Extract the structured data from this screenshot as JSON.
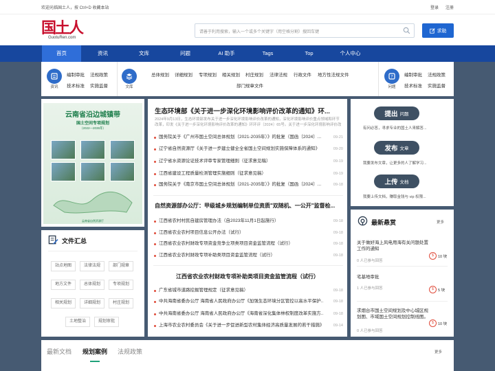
{
  "topbar": {
    "welcome": "欢迎光临国土人，按 Ctrl+D 收藏本站",
    "login": "登录",
    "register": "注册"
  },
  "logo": {
    "mark": "国土人",
    "domain": "GuotuRen.com"
  },
  "search": {
    "placeholder": "请善于利用搜索，输入一个或多个关键字（用空格分割）搜回车键",
    "ask_label": "求助"
  },
  "nav": [
    "首页",
    "资讯",
    "文库",
    "问题",
    "AI 助手",
    "Tags",
    "Top",
    "个人中心"
  ],
  "catbar": {
    "news": {
      "caption": "资讯",
      "links": [
        "编制审批",
        "法规政策",
        "技术标准",
        "实施监督"
      ]
    },
    "library": {
      "caption": "文库",
      "links": [
        "总体规划",
        "详细规划",
        "专项规划",
        "相关规划",
        "村庄规划",
        "法律法规",
        "行政文件",
        "地方性法规文件",
        "部门规章文件"
      ]
    },
    "questions": {
      "caption": "问题",
      "links": [
        "编制审批",
        "法规政策",
        "技术标准",
        "实施监督"
      ]
    }
  },
  "poster": {
    "title": "云南省沿边城镇带",
    "subtitle": "国土空间专项规划",
    "years": "（2022—2035年）",
    "footer": "云南省自然资源厅"
  },
  "files": {
    "title": "文件汇总",
    "tags": [
      "站点地图",
      "法律法规",
      "部门规章",
      "地方文件",
      "总体规划",
      "专项规划",
      "相关规划",
      "详细规划",
      "村庄规划",
      "土地整治",
      "规划审批"
    ]
  },
  "news": {
    "headline1": "生态环境部《关于进一步深化环境影响评价改革的通知》环...",
    "summary1": "2024年9月13日，生态环境部发布关于进一步深化环境影响评价改革的通知，深化环境影响评价重点领域和环节改革，印发《关于进一步深化环境影响评价改革的通知》环环评〔2024〕65号。关于进一步深化环境影响评价改革的通",
    "list1": [
      {
        "title": "国务院关于《广州市国土空间总体规划（2021-2035年）》的批复（国函〔2024〕...",
        "date": "09-21"
      },
      {
        "title": "辽宁省自然资源厅《关于进一步建立健全全省国土空间规划实施保障体系的通知》",
        "date": "09-20"
      },
      {
        "title": "辽宁省水资源论证技术评审专家管理细则（征求意见稿）",
        "date": "09-19"
      },
      {
        "title": "江西省建设工程质量检测管理实施细则（征求意见稿）",
        "date": "09-19"
      },
      {
        "title": "国务院关于《南京市国土空间总体规划（2021-2035年）》的批复（国函〔2024〕...",
        "date": "09-18"
      }
    ],
    "headline2": "自然资源部办公厅：甲级城乡规划编制单位资质\"双随机、一公开\"监督检...",
    "list2": [
      {
        "title": "江西省农村村民自建房管理办法（自2023年11月1日起施行）",
        "date": "09-18"
      },
      {
        "title": "江西省农业农村项目信息公开办法（试行）",
        "date": "09-18"
      },
      {
        "title": "江西省农业农村财政专项资金竞争立项类项目资金监管流程（试行）",
        "date": "09-18"
      },
      {
        "title": "江西省农业农村财政专项补助类项目资金监管流程（试行）",
        "date": "09-18"
      }
    ],
    "headline3": "江西省农业农村财政专项补助类项目资金监管流程（试行）",
    "list3": [
      {
        "title": "广东省城市道路挖掘管理规定（征求意见稿）",
        "date": "09-18"
      },
      {
        "title": "中共海南省委办公厅 海南省人民政府办公厅《加强生态环境分区管控以高水平保护...",
        "date": "09-18"
      },
      {
        "title": "中共海南省委办公厅 海南省人民政府办公厅《海南省深化集体林权制度改革实施方...",
        "date": "09-18"
      },
      {
        "title": "上海市农业农村委员会《关于进一步促进新型农村集体经济高质量发展的若干措施》...",
        "date": "09-14"
      }
    ]
  },
  "actions": [
    {
      "verb": "提出",
      "noun": "问题",
      "desc": "有问必答，寻求专业的国土人来解答..."
    },
    {
      "verb": "发布",
      "noun": "文章",
      "desc": "我要发布文章，让更多的人了解学习..."
    },
    {
      "verb": "上传",
      "noun": "文档",
      "desc": "我要上传文档，赚取金钱与 vip 权限..."
    }
  ],
  "hot": {
    "title": "最新悬赏",
    "more": "更多",
    "items": [
      {
        "question": "关于做好海上风电用海有关问题处置工作的通知",
        "meta": "0 人已参与回答",
        "reward": "10",
        "unit": "块"
      },
      {
        "question": "宅基地审批",
        "meta": "1 人已参与回答",
        "reward": "5",
        "unit": "块"
      },
      {
        "question": "求烟台市国土空间规划及中心城区规划图、市域国土空间规划控制线图。",
        "meta": "0 人已参与回答",
        "reward": "10",
        "unit": "块"
      }
    ]
  },
  "bottom": {
    "tabs": [
      "最新文档",
      "规划案例",
      "法规政策"
    ],
    "more": "更多"
  },
  "colors": {
    "nav": "#17479e",
    "nav_active": "#2f6ed9",
    "button": "#1f66d1",
    "page_bg": "#465a72",
    "accent_red": "#e04b3a",
    "pill": "#3e5063"
  }
}
